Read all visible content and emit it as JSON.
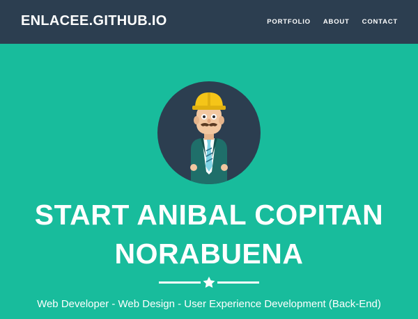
{
  "navbar": {
    "brand": "ENLACEE.GITHUB.IO",
    "links": [
      "PORTFOLIO",
      "ABOUT",
      "CONTACT"
    ]
  },
  "header": {
    "title_line1": "START ANIBAL COPITAN",
    "title_line2": "NORABUENA",
    "subtitle": "Web Developer - Web Design - User Experience Development (Back-End)",
    "divider_icon": "star-icon",
    "avatar_icon": "construction-worker-avatar-icon"
  },
  "colors": {
    "navbar_bg": "#2c3e50",
    "header_bg": "#18bc9c",
    "avatar_circle": "#2c3e50",
    "text": "#ffffff",
    "hard_hat": "#f5c518"
  }
}
